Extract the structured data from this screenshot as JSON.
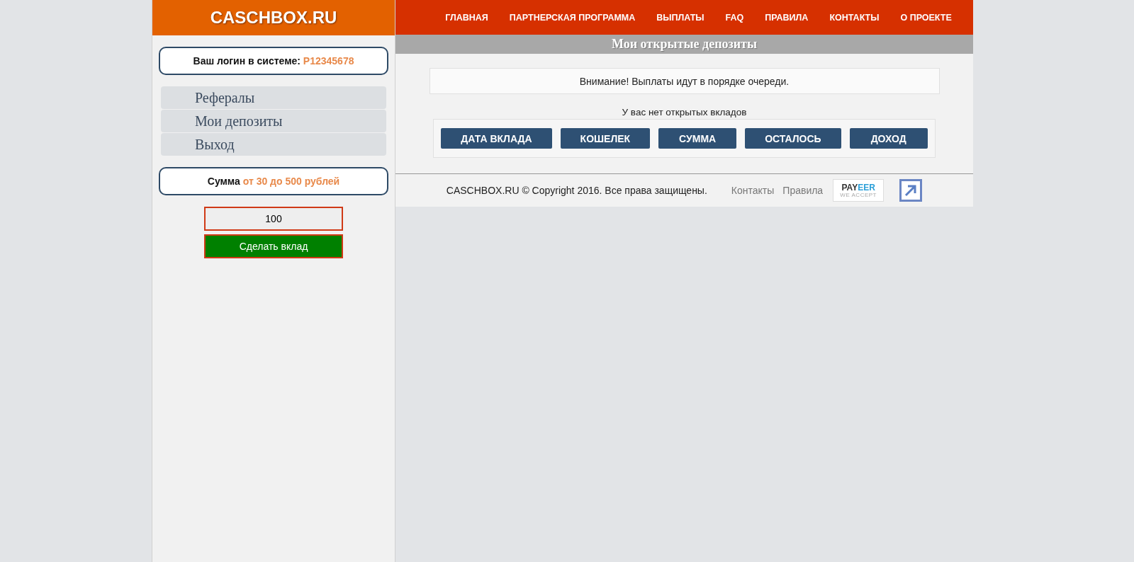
{
  "logo": "CASCHBOX.RU",
  "login": {
    "label": "Ваш логин в системе:",
    "value": "P12345678"
  },
  "sidebar_menu": [
    {
      "label": "Рефералы"
    },
    {
      "label": "Мои депозиты"
    },
    {
      "label": "Выход"
    }
  ],
  "amount_note": {
    "label": "Сумма",
    "value": "от 30 до 500 рублей"
  },
  "deposit_form": {
    "value": "100",
    "button": "Сделать вклад"
  },
  "nav": [
    "ГЛАВНАЯ",
    "ПАРТНЕРСКАЯ ПРОГРАММА",
    "ВЫПЛАТЫ",
    "FAQ",
    "ПРАВИЛА",
    "КОНТАКТЫ",
    "О ПРОЕКТЕ"
  ],
  "page_title": "Мои открытые депозиты",
  "notice": "Внимание! Выплаты идут в порядке очереди.",
  "empty_message": "У вас нет открытых вкладов",
  "table": {
    "columns": [
      "ДАТА ВКЛАДА",
      "КОШЕЛЕК",
      "СУММА",
      "ОСТАЛОСЬ",
      "ДОХОД"
    ]
  },
  "footer": {
    "copyright": "CASCHBOX.RU © Copyright 2016. Все права защищены.",
    "links": [
      "Контакты",
      "Правила"
    ],
    "payeer": {
      "name": "PAYEER",
      "tagline": "WE ACCEPT"
    }
  }
}
